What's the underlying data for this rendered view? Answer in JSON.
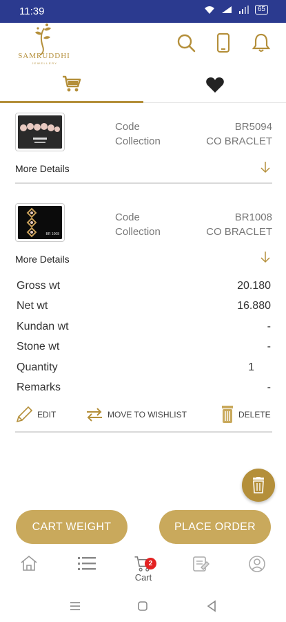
{
  "status_bar": {
    "time": "11:39",
    "battery": "65"
  },
  "brand": {
    "name": "SAMRUDDHI",
    "tagline": "JEWELLERY"
  },
  "colors": {
    "accent": "#b48f3a",
    "status_bar": "#2b3a8f",
    "button": "#c9a95c",
    "badge": "#e32222"
  },
  "header_icons": [
    "search-icon",
    "phone-icon",
    "bell-icon"
  ],
  "tabs": [
    {
      "name": "cart",
      "icon": "cart-icon",
      "active": true
    },
    {
      "name": "wishlist",
      "icon": "heart-icon",
      "active": false
    }
  ],
  "items": [
    {
      "code_label": "Code",
      "code": "BR5094",
      "collection_label": "Collection",
      "collection": "CO BRACLET",
      "more_details": "More Details",
      "expanded": false
    },
    {
      "code_label": "Code",
      "code": "BR1008",
      "collection_label": "Collection",
      "collection": "CO BRACLET",
      "more_details": "More Details",
      "expanded": true,
      "details": [
        {
          "label": "Gross wt",
          "value": "20.180"
        },
        {
          "label": "Net wt",
          "value": "16.880"
        },
        {
          "label": "Kundan wt",
          "value": "-"
        },
        {
          "label": "Stone wt",
          "value": "-"
        },
        {
          "label": "Quantity",
          "value": "1"
        },
        {
          "label": "Remarks",
          "value": "-"
        }
      ],
      "actions": {
        "edit": "EDIT",
        "move": "MOVE TO WISHLIST",
        "delete": "DELETE"
      },
      "thumb_label": "BR 1008"
    }
  ],
  "buttons": {
    "cart_weight": "CART WEIGHT",
    "place_order": "PLACE ORDER"
  },
  "bottom_nav": {
    "cart_label": "Cart",
    "cart_count": "2"
  }
}
